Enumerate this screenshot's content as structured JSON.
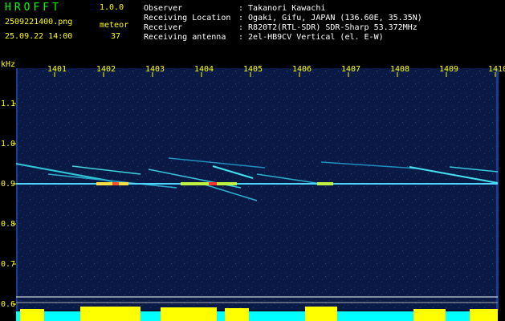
{
  "header": {
    "app_title": "HROFFT",
    "version": "1.0.0",
    "filename": "2509221400.png",
    "datetime": "25.09.22 14:00",
    "meteor_label": "meteor",
    "meteor_count": "37"
  },
  "info": [
    {
      "label": "Observer",
      "value": ": Takanori Kawachi"
    },
    {
      "label": "Receiving Location",
      "value": ": Ogaki, Gifu, JAPAN (136.60E, 35.35N)"
    },
    {
      "label": "Receiver",
      "value": ": R820T2(RTL-SDR) SDR-Sharp 53.372MHz"
    },
    {
      "label": "Receiving antenna",
      "value": ": 2el-HB9CV Vertical (el. E-W)"
    }
  ],
  "chart_data": {
    "type": "heatmap",
    "y_unit": "kHz",
    "x_ticks": [
      "1401",
      "1402",
      "1403",
      "1404",
      "1405",
      "1406",
      "1407",
      "1408",
      "1409",
      "1410"
    ],
    "y_ticks": [
      "1.1",
      "1.0",
      "0.9",
      "0.8",
      "0.7",
      "0.6"
    ],
    "ylim": [
      0.6,
      1.1
    ],
    "carrier_khz": 0.9
  },
  "colors": {
    "background": "#000000",
    "noise": "#0c1d4a",
    "text_yellow": "#ffff00",
    "text_white": "#ffffff",
    "text_green": "#00ff00",
    "meter_cyan": "#00ffff",
    "meter_yellow": "#ffff00"
  }
}
